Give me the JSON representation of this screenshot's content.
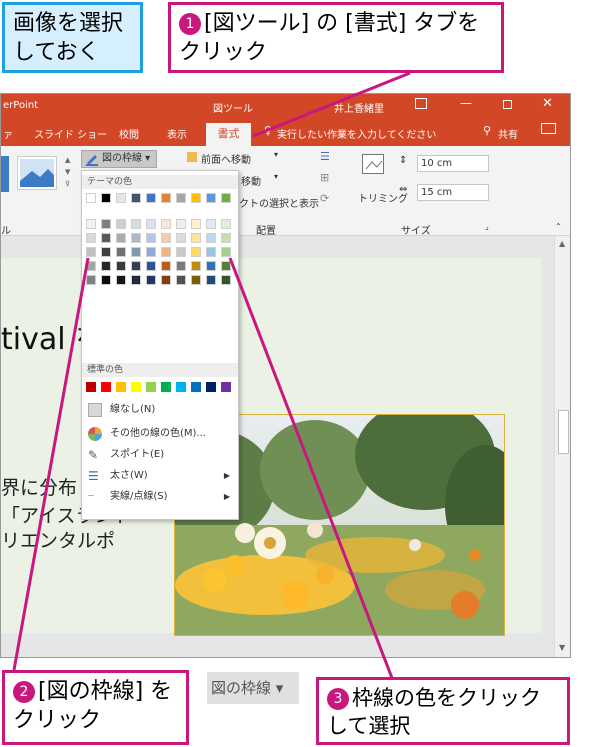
{
  "callouts": {
    "intro": {
      "text": "画像を選択しておく"
    },
    "step1": {
      "num": "1",
      "text": "[図ツール] の [書式] タブをクリック"
    },
    "step2": {
      "num": "2",
      "text": "[図の枠線] をクリック"
    },
    "step3": {
      "num": "3",
      "text": "枠線の色をクリックして選択"
    }
  },
  "titlebar": {
    "app": "erPoint",
    "context": "図ツール",
    "user": "井上香緒里"
  },
  "tabs": [
    {
      "label": "ァ"
    },
    {
      "label": "スライド ショー"
    },
    {
      "label": "校閲"
    },
    {
      "label": "表示"
    },
    {
      "label": "書式"
    }
  ],
  "tell_me": "実行したい作業を入力してください",
  "share": "共有",
  "ribbon": {
    "border_button": "図の枠線",
    "bring_forward": "前面へ移動",
    "send_backward": "移動",
    "selection_pane": "クトの選択と表示",
    "arrange_group": "配置",
    "crop": "トリミング",
    "height": "10 cm",
    "width": "15 cm",
    "size_group": "サイズ",
    "style_group": "ル"
  },
  "dropdown": {
    "theme_header": "テーマの色",
    "standard_header": "標準の色",
    "theme_colors": [
      [
        "#ffffff",
        "#000000",
        "#e7e6e6",
        "#44546a",
        "#4472c4",
        "#ed7d31",
        "#a5a5a5",
        "#ffc000",
        "#5b9bd5",
        "#70ad47"
      ],
      [
        "#f2f2f2",
        "#7f7f7f",
        "#d0cece",
        "#d6dce4",
        "#d9e2f3",
        "#fbe5d5",
        "#ededed",
        "#fff2cc",
        "#deebf6",
        "#e2efd9"
      ],
      [
        "#d9d9d9",
        "#595959",
        "#aeabab",
        "#adb9ca",
        "#b4c6e7",
        "#f7cbac",
        "#dbdbdb",
        "#fee599",
        "#bdd7ee",
        "#c5e0b3"
      ],
      [
        "#bfbfbf",
        "#3f3f3f",
        "#757070",
        "#8496b0",
        "#8eaadb",
        "#f4b183",
        "#c9c9c9",
        "#ffd965",
        "#9cc3e5",
        "#a8d08d"
      ],
      [
        "#a5a5a5",
        "#262626",
        "#3a3838",
        "#323f4f",
        "#2f5496",
        "#c55a11",
        "#7b7b7b",
        "#bf8f00",
        "#2e75b5",
        "#538135"
      ],
      [
        "#7f7f7f",
        "#0c0c0c",
        "#171616",
        "#222a35",
        "#1f3864",
        "#833c0b",
        "#525252",
        "#7f6000",
        "#1e4e79",
        "#375623"
      ]
    ],
    "standard_colors": [
      "#c00000",
      "#ff0000",
      "#ffc000",
      "#ffff00",
      "#92d050",
      "#00b050",
      "#00b0f0",
      "#0070c0",
      "#002060",
      "#7030a0"
    ],
    "no_line": "線なし(N)",
    "more_colors": "その他の線の色(M)...",
    "eyedropper": "スポイト(E)",
    "weight": "太さ(W)",
    "dashes": "実線/点線(S)"
  },
  "slide": {
    "title_fragment": "tival を",
    "line1": "界に分布",
    "line2": "「アイスランド",
    "line3": "リエンタルポ"
  },
  "bottom_button": {
    "label": "図の枠線"
  },
  "colors": {
    "accent_magenta": "#c8187e",
    "accent_blue": "#1ea0e0",
    "ppt_orange": "#d24726"
  }
}
